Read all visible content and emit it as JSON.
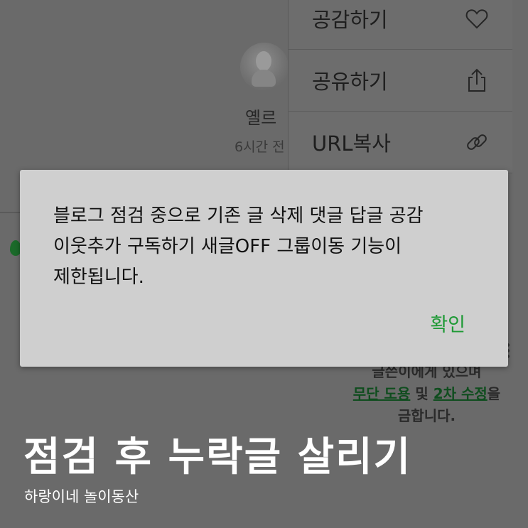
{
  "profile": {
    "name": "옐르",
    "time": "6시간 전"
  },
  "menu": {
    "items": [
      {
        "label": "공감하기",
        "icon": "heart-icon"
      },
      {
        "label": "공유하기",
        "icon": "share-icon"
      },
      {
        "label": "URL복사",
        "icon": "link-icon"
      }
    ]
  },
  "notice": {
    "line1": "글쓴이에게 있으며",
    "unauthorized_use": "무단 도용",
    "and": " 및 ",
    "secondary_edit": "2차 수정",
    "suffix": "을",
    "line3": "금합니다."
  },
  "dialog": {
    "message": "블로그 점검 중으로 기존 글 삭제 댓글 답글 공감 이웃추가 구독하기 새글OFF 그룹이동 기능이 제한됩니다.",
    "confirm_label": "확인",
    "confirm_color": "#1f9a36"
  },
  "caption": {
    "title": "점검 후 누락글 살리기",
    "subtitle": "하랑이네 놀이동산"
  }
}
